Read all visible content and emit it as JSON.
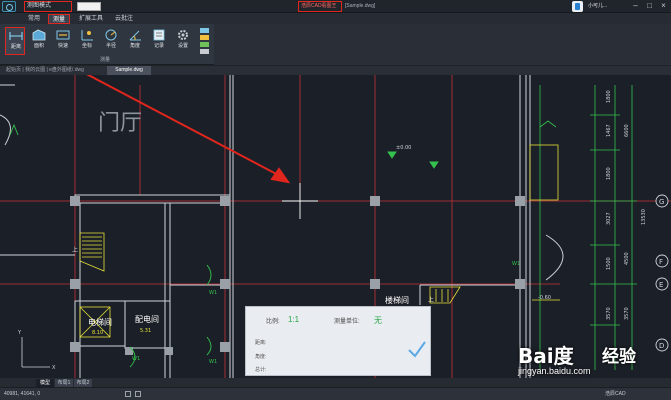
{
  "titlebar": {
    "mode_label": "测图模式",
    "app_title": "浩辰CAD看图王",
    "doc_title": "[Sample.dwg]",
    "username": "小可儿...",
    "minimize": "–",
    "maximize": "□",
    "close": "×"
  },
  "menu": {
    "tabs": [
      {
        "label": "常用"
      },
      {
        "label": "测量"
      },
      {
        "label": "扩展工具"
      },
      {
        "label": "云批注"
      }
    ]
  },
  "ribbon": {
    "group_label": "测量",
    "buttons": [
      {
        "label": "距离",
        "icon": "distance-icon"
      },
      {
        "label": "面积",
        "icon": "area-icon"
      },
      {
        "label": "快速",
        "icon": "quick-icon"
      },
      {
        "label": "坐标",
        "icon": "coordinate-icon"
      },
      {
        "label": "半径",
        "icon": "radius-icon"
      },
      {
        "label": "角度",
        "icon": "angle-icon"
      },
      {
        "label": "记录",
        "icon": "record-icon"
      },
      {
        "label": "设置",
        "icon": "settings-icon"
      }
    ]
  },
  "doctabs": {
    "path": "起始页 | 我的云图 | e盘外图纸/.dwg",
    "active_tab": "Sample.dwg"
  },
  "drawing": {
    "room_lobby": "门厅",
    "room_elevator": "电梯间",
    "elevator_area": "8.10",
    "room_power": "配电间",
    "power_area": "5.31",
    "room_right": "楼梯间",
    "elev_mark_1": "±0.00",
    "elev_mark_2": "-0.60",
    "up_left": "上",
    "up_right": "上",
    "win_1": "W1",
    "win_2": "W1",
    "win_3": "W1",
    "win_4": "W1",
    "axis_g": "G",
    "axis_f": "F",
    "axis_e": "E",
    "axis_d": "D",
    "dim_1": "1800",
    "dim_2": "1467",
    "dim_3": "6600",
    "dim_4": "1800",
    "dim_5": "3027",
    "dim_6": "4500",
    "dim_7": "13530",
    "dim_8": "1500",
    "dim_9": "3570",
    "dim_10": "3570",
    "ucs_y": "Y",
    "ucs_x": "X"
  },
  "measure_panel": {
    "scale_label": "比例:",
    "scale_value": "1:1",
    "unit_label": "测量单位:",
    "unit_value": "无",
    "distance_label": "距离:",
    "angle_label": "角度:",
    "total_label": "总计:"
  },
  "layout_tabs": [
    {
      "label": "模型"
    },
    {
      "label": "布局1"
    },
    {
      "label": "布局2"
    }
  ],
  "status": {
    "coords": "40981, 41641, 0",
    "right_text": "浩辰CAD"
  },
  "watermark": {
    "brand": "Bai度",
    "site": "经验",
    "url": "jingyan.baidu.com"
  },
  "colors": {
    "accent_red": "#e0261d",
    "canvas_bg": "#1b1f27",
    "grid_red": "#c8323a",
    "wall_white": "#cfd3d8",
    "green": "#33c24d",
    "yellow": "#e8e23a"
  }
}
